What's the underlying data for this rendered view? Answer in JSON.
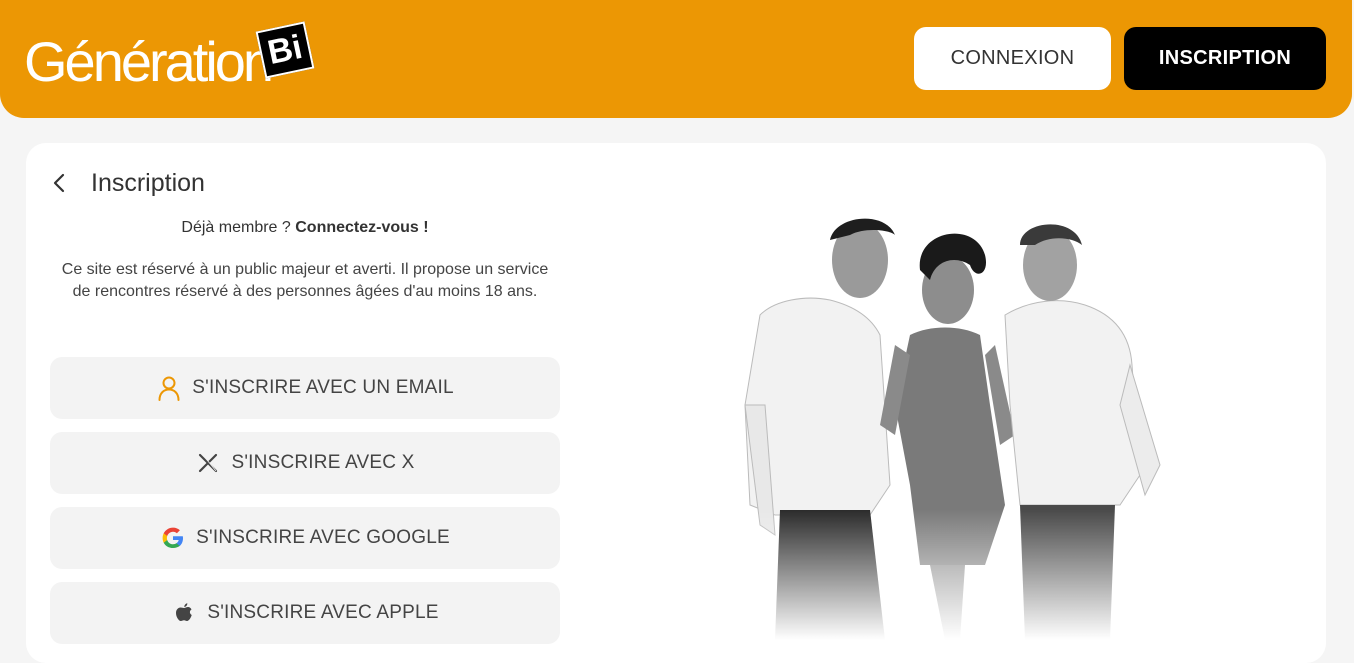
{
  "header": {
    "logo_text": "Génération",
    "logo_badge": "Bi",
    "login_label": "CONNEXION",
    "signup_label": "INSCRIPTION"
  },
  "page": {
    "title": "Inscription",
    "member_prompt": "Déjà membre ? ",
    "member_link": "Connectez-vous !",
    "disclaimer": "Ce site est réservé à un public majeur et averti. Il propose un service de rencontres réservé à des personnes âgées d'au moins 18 ans."
  },
  "signup_options": [
    {
      "label": "S'INSCRIRE AVEC UN EMAIL",
      "icon": "user-icon"
    },
    {
      "label": "S'INSCRIRE AVEC X",
      "icon": "x-logo-icon"
    },
    {
      "label": "S'INSCRIRE AVEC GOOGLE",
      "icon": "google-logo-icon"
    },
    {
      "label": "S'INSCRIRE AVEC APPLE",
      "icon": "apple-logo-icon"
    }
  ],
  "colors": {
    "brand": "#ec9704",
    "background": "#f5f5f5",
    "button_bg": "#f3f3f3"
  }
}
